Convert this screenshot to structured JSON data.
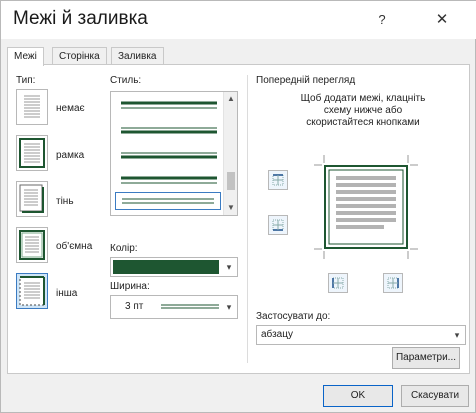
{
  "window": {
    "title": "Межі й заливка",
    "help_glyph": "?",
    "close_glyph": "✕"
  },
  "tabs": [
    {
      "label": "Межі",
      "active": true
    },
    {
      "label": "Сторінка",
      "active": false
    },
    {
      "label": "Заливка",
      "active": false
    }
  ],
  "setting": {
    "label": "Тип:",
    "options": [
      {
        "label": "немає",
        "icon": "none-border-icon",
        "selected": false
      },
      {
        "label": "рамка",
        "icon": "box-border-icon",
        "selected": false
      },
      {
        "label": "тінь",
        "icon": "shadow-border-icon",
        "selected": false
      },
      {
        "label": "об'ємна",
        "icon": "3d-border-icon",
        "selected": false
      },
      {
        "label": "інша",
        "icon": "custom-border-icon",
        "selected": true
      }
    ]
  },
  "style": {
    "label": "Стиль:",
    "selected_index": 3
  },
  "color": {
    "label": "Колір:",
    "value": "#1e5631"
  },
  "width": {
    "label": "Ширина:",
    "value": "3 пт"
  },
  "preview": {
    "label": "Попередній перегляд",
    "hint": "Щоб додати межі, клацніть схему нижче або скористайтеся кнопками",
    "apply_label": "Застосувати до:",
    "apply_value": "абзацу",
    "params_button": "Параметри..."
  },
  "buttons": {
    "ok": "OK",
    "cancel": "Скасувати"
  },
  "colors": {
    "border_green": "#1e5631",
    "selection_blue": "#cfe5f7",
    "accent_blue": "#3b7bc2"
  }
}
